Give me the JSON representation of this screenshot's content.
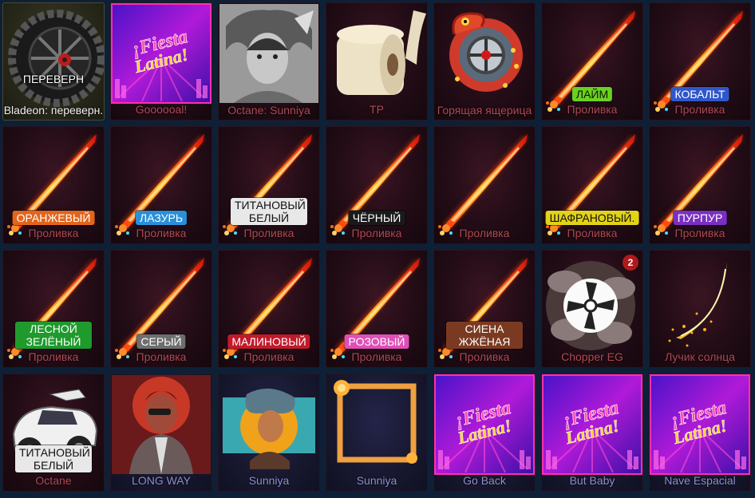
{
  "tiles": [
    {
      "name": "Bladeon: переверн.",
      "kind": "wheel-upside",
      "style": "gold",
      "overlay": "ПЕРЕВЕРН"
    },
    {
      "name": "Goooooal!",
      "kind": "fiesta",
      "style": "red"
    },
    {
      "name": "Octane: Sunniya",
      "kind": "portrait-gray",
      "style": "red"
    },
    {
      "name": "TP",
      "kind": "toilet-paper",
      "style": "red"
    },
    {
      "name": "Горящая ящерица",
      "kind": "lizard-wheel",
      "style": "red"
    },
    {
      "name": "Проливка",
      "kind": "sword",
      "style": "red",
      "badge": "ЛАЙМ",
      "badge_color": "#6ad21e",
      "badge_dark": true
    },
    {
      "name": "Проливка",
      "kind": "sword",
      "style": "red",
      "badge": "КОБАЛЬТ",
      "badge_color": "#2f57c9"
    },
    {
      "name": "Проливка",
      "kind": "sword",
      "style": "red",
      "badge": "ОРАНЖЕВЫЙ",
      "badge_color": "#e2651c"
    },
    {
      "name": "Проливка",
      "kind": "sword",
      "style": "red",
      "badge": "ЛАЗУРЬ",
      "badge_color": "#2a8fd8"
    },
    {
      "name": "Проливка",
      "kind": "sword",
      "style": "red",
      "badge": "ТИТАНОВЫЙ БЕЛЫЙ",
      "badge_color": "#e8e8e8",
      "badge_dark": true
    },
    {
      "name": "Проливка",
      "kind": "sword",
      "style": "red",
      "badge": "ЧЁРНЫЙ",
      "badge_color": "#1a1a1a"
    },
    {
      "name": "Проливка",
      "kind": "sword",
      "style": "red"
    },
    {
      "name": "Проливка",
      "kind": "sword",
      "style": "red",
      "badge": "ШАФРАНОВЫЙ.",
      "badge_color": "#e2d218",
      "badge_dark": true
    },
    {
      "name": "Проливка",
      "kind": "sword",
      "style": "red",
      "badge": "ПУРПУР",
      "badge_color": "#7b2ec2"
    },
    {
      "name": "Проливка",
      "kind": "sword",
      "style": "red",
      "badge": "ЛЕСНОЙ ЗЕЛЁНЫЙ",
      "badge_color": "#1f9a2c"
    },
    {
      "name": "Проливка",
      "kind": "sword",
      "style": "red",
      "badge": "СЕРЫЙ",
      "badge_color": "#6e6e6e"
    },
    {
      "name": "Проливка",
      "kind": "sword",
      "style": "red",
      "badge": "МАЛИНОВЫЙ",
      "badge_color": "#c11a2a"
    },
    {
      "name": "Проливка",
      "kind": "sword",
      "style": "red",
      "badge": "РОЗОВЫЙ",
      "badge_color": "#e04fb8"
    },
    {
      "name": "Проливка",
      "kind": "sword",
      "style": "red",
      "badge": "СИЕНА ЖЖЁНАЯ",
      "badge_color": "#7a3a22"
    },
    {
      "name": "Chopper EG",
      "kind": "chopper",
      "style": "red",
      "count": "2"
    },
    {
      "name": "Лучик солнца",
      "kind": "sunbeam",
      "style": "red"
    },
    {
      "name": "Octane",
      "kind": "car",
      "style": "red",
      "badge": "ТИТАНОВЫЙ БЕЛЫЙ",
      "badge_color": "#e8e8e8",
      "badge_dark": true
    },
    {
      "name": "LONG WAY",
      "kind": "portrait-red",
      "style": "blue"
    },
    {
      "name": "Sunniya",
      "kind": "sunniya",
      "style": "blue"
    },
    {
      "name": "Sunniya",
      "kind": "frame",
      "style": "blue"
    },
    {
      "name": "Go Back",
      "kind": "fiesta",
      "style": "blue"
    },
    {
      "name": "But Baby",
      "kind": "fiesta",
      "style": "blue"
    },
    {
      "name": "Nave Espacial",
      "kind": "fiesta",
      "style": "blue"
    }
  ],
  "fiesta_text": "¡Fiesta Latina!",
  "colors": {
    "background": "#0e2036",
    "tile_name_red": "#b04a52",
    "tile_name_blue": "#8f8fd0"
  }
}
